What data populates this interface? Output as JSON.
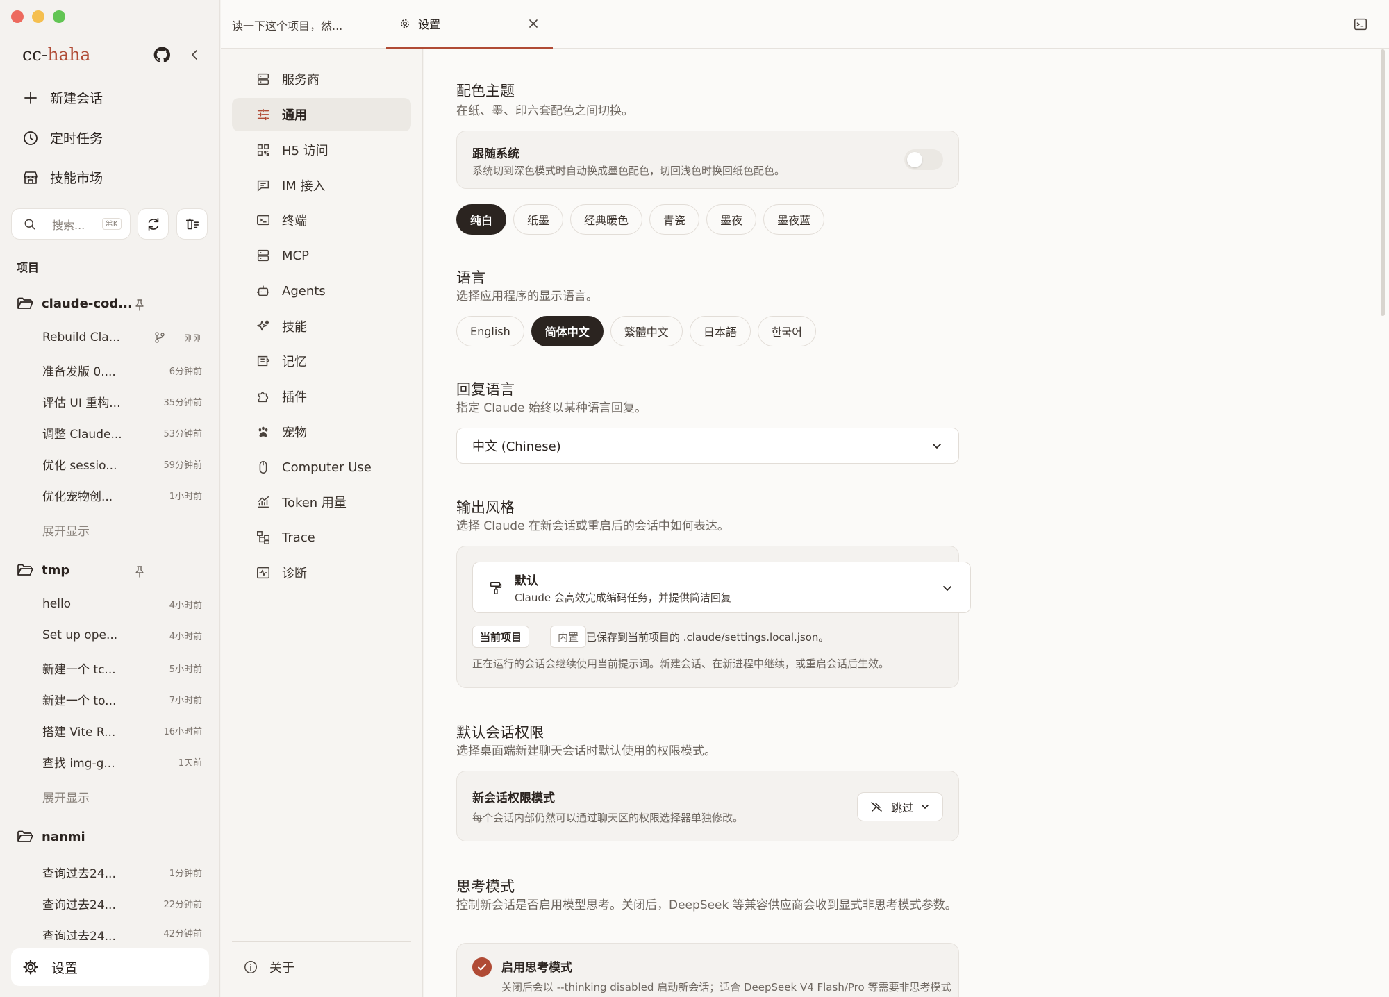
{
  "app": {
    "title_prefix": "cc-",
    "title_accent": "haha"
  },
  "sidebar": {
    "nav": [
      {
        "label": "新建会话"
      },
      {
        "label": "定时任务"
      },
      {
        "label": "技能市场"
      }
    ],
    "search": {
      "placeholder": "搜索...",
      "shortcut": "⌘K"
    },
    "projects_label": "项目",
    "projects": [
      {
        "name": "claude-cod...",
        "sessions": [
          {
            "title": "Rebuild Cla...",
            "time": "刚刚"
          },
          {
            "title": "准备发版 0....",
            "time": "6分钟前"
          },
          {
            "title": "评估 UI 重构...",
            "time": "35分钟前"
          },
          {
            "title": "调整 Claude...",
            "time": "53分钟前"
          },
          {
            "title": "优化 sessio...",
            "time": "59分钟前"
          },
          {
            "title": "优化宠物创...",
            "time": "1小时前"
          }
        ],
        "expand": "展开显示"
      },
      {
        "name": "tmp",
        "sessions": [
          {
            "title": "hello",
            "time": "4小时前"
          },
          {
            "title": "Set up ope...",
            "time": "4小时前"
          },
          {
            "title": "新建一个 tc...",
            "time": "5小时前"
          },
          {
            "title": "新建一个 to...",
            "time": "7小时前"
          },
          {
            "title": "搭建 Vite R...",
            "time": "16小时前"
          },
          {
            "title": "查找 img-g...",
            "time": "1天前"
          }
        ],
        "expand": "展开显示"
      },
      {
        "name": "nanmi",
        "sessions": [
          {
            "title": "查询过去24...",
            "time": "1分钟前"
          },
          {
            "title": "查询过去24...",
            "time": "22分钟前"
          },
          {
            "title": "查询过去24...",
            "time": "42分钟前"
          }
        ]
      }
    ],
    "settings_label": "设置"
  },
  "tabs": [
    {
      "label": "读一下这个项目，然..."
    },
    {
      "label": "设置"
    }
  ],
  "settings_nav": {
    "items": [
      {
        "label": "服务商",
        "icon": "server-icon"
      },
      {
        "label": "通用",
        "icon": "sliders-icon"
      },
      {
        "label": "H5 访问",
        "icon": "qr-icon"
      },
      {
        "label": "IM 接入",
        "icon": "message-icon"
      },
      {
        "label": "终端",
        "icon": "terminal-icon"
      },
      {
        "label": "MCP",
        "icon": "server-icon"
      },
      {
        "label": "Agents",
        "icon": "bot-icon"
      },
      {
        "label": "技能",
        "icon": "sparkles-icon"
      },
      {
        "label": "记忆",
        "icon": "memory-icon"
      },
      {
        "label": "插件",
        "icon": "puzzle-icon"
      },
      {
        "label": "宠物",
        "icon": "paw-icon"
      },
      {
        "label": "Computer Use",
        "icon": "mouse-icon"
      },
      {
        "label": "Token 用量",
        "icon": "chart-icon"
      },
      {
        "label": "Trace",
        "icon": "trace-icon"
      },
      {
        "label": "诊断",
        "icon": "diagnose-icon"
      }
    ],
    "active_index": 1,
    "about": "关于"
  },
  "theme": {
    "title": "配色主题",
    "subtitle": "在纸、墨、印六套配色之间切换。",
    "follow_system": {
      "title": "跟随系统",
      "desc": "系统切到深色模式时自动换成墨色配色，切回浅色时换回纸色配色。",
      "enabled": false
    },
    "options": [
      "纯白",
      "纸墨",
      "经典暖色",
      "青瓷",
      "墨夜",
      "墨夜蓝"
    ],
    "selected": "纯白"
  },
  "language": {
    "title": "语言",
    "subtitle": "选择应用程序的显示语言。",
    "options": [
      "English",
      "简体中文",
      "繁體中文",
      "日本語",
      "한국어"
    ],
    "selected": "简体中文"
  },
  "reply_language": {
    "title": "回复语言",
    "subtitle": "指定 Claude 始终以某种语言回复。",
    "value": "中文 (Chinese)"
  },
  "output_style": {
    "title": "输出风格",
    "subtitle": "选择 Claude 在新会话或重启后的会话中如何表达。",
    "selected_name": "默认",
    "selected_desc": "Claude 会高效完成编码任务，并提供简洁回复",
    "tag_project": "当前项目",
    "tag_builtin": "内置",
    "saved_note": "已保存到当前项目的 .claude/settings.local.json。",
    "running_note": "正在运行的会话会继续使用当前提示词。新建会话、在新进程中继续，或重启会话后生效。"
  },
  "permissions": {
    "title": "默认会话权限",
    "subtitle": "选择桌面端新建聊天会话时默认使用的权限模式。",
    "card_title": "新会话权限模式",
    "card_desc": "每个会话内部仍然可以通过聊天区的权限选择器单独修改。",
    "value": "跳过"
  },
  "thinking": {
    "title": "思考模式",
    "subtitle": "控制新会话是否启用模型思考。关闭后，DeepSeek 等兼容供应商会收到显式非思考模式参数。",
    "card_title": "启用思考模式",
    "card_desc": "关闭后会以 --thinking disabled 启动新会话；适合 DeepSeek V4 Flash/Pro 等需要非思考模式",
    "enabled": true
  },
  "colors": {
    "accent": "#b04b35",
    "dark": "#2b2420"
  }
}
